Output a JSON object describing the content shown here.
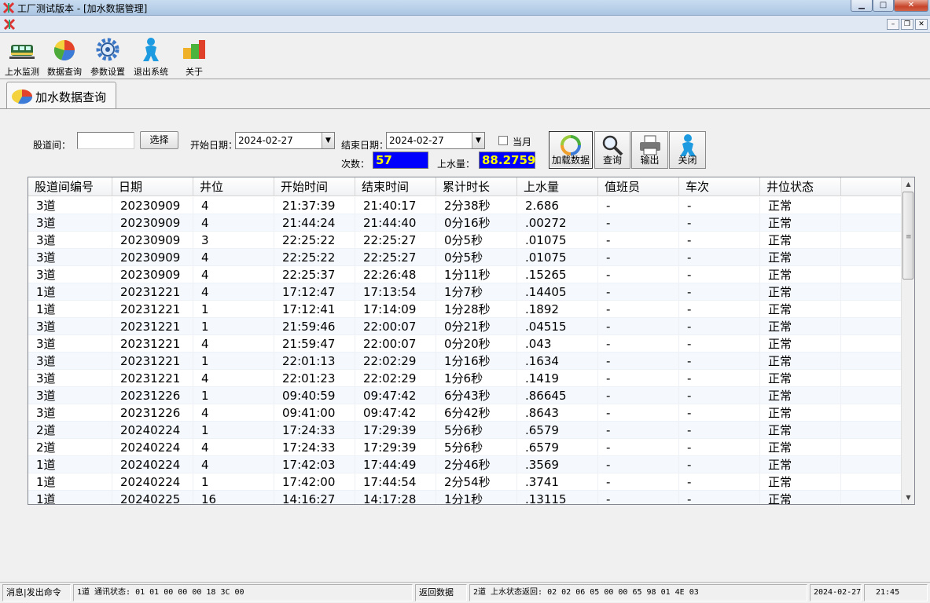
{
  "window": {
    "title": "工厂测试版本 - [加水数据管理]"
  },
  "toolbar": {
    "items": [
      {
        "label": "上水监测",
        "icon": "train-icon"
      },
      {
        "label": "数据查询",
        "icon": "pie-chart-icon"
      },
      {
        "label": "参数设置",
        "icon": "settings-icon"
      },
      {
        "label": "退出系统",
        "icon": "exit-person-icon"
      },
      {
        "label": "关于",
        "icon": "about-blocks-icon"
      }
    ]
  },
  "tab": {
    "label": "加水数据查询"
  },
  "form": {
    "track_label": "股道间：",
    "track_value": "",
    "select_button": "选择",
    "start_date_label": "开始日期：",
    "start_date": "2024-02-27",
    "end_date_label": "结束日期：",
    "end_date": "2024-02-27",
    "month_checkbox_label": "当月",
    "count_label": "次数：",
    "count_value": "57",
    "water_label": "上水量：",
    "water_value": "88.2759"
  },
  "actions": {
    "load": "加载数据",
    "query": "查询",
    "export": "输出",
    "close": "关闭"
  },
  "table": {
    "columns": [
      "股道间编号",
      "日期",
      "井位",
      "开始时间",
      "结束时间",
      "累计时长",
      "上水量",
      "值班员",
      "车次",
      "井位状态"
    ],
    "rows": [
      [
        "3道",
        "20230909",
        "4",
        "21:37:39",
        "21:40:17",
        "2分38秒",
        "2.686",
        "-",
        "-",
        "正常"
      ],
      [
        "3道",
        "20230909",
        "4",
        "21:44:24",
        "21:44:40",
        "0分16秒",
        ".00272",
        "-",
        "-",
        "正常"
      ],
      [
        "3道",
        "20230909",
        "3",
        "22:25:22",
        "22:25:27",
        "0分5秒",
        ".01075",
        "-",
        "-",
        "正常"
      ],
      [
        "3道",
        "20230909",
        "4",
        "22:25:22",
        "22:25:27",
        "0分5秒",
        ".01075",
        "-",
        "-",
        "正常"
      ],
      [
        "3道",
        "20230909",
        "4",
        "22:25:37",
        "22:26:48",
        "1分11秒",
        ".15265",
        "-",
        "-",
        "正常"
      ],
      [
        "1道",
        "20231221",
        "4",
        "17:12:47",
        "17:13:54",
        "1分7秒",
        ".14405",
        "-",
        "-",
        "正常"
      ],
      [
        "1道",
        "20231221",
        "1",
        "17:12:41",
        "17:14:09",
        "1分28秒",
        ".1892",
        "-",
        "-",
        "正常"
      ],
      [
        "3道",
        "20231221",
        "1",
        "21:59:46",
        "22:00:07",
        "0分21秒",
        ".04515",
        "-",
        "-",
        "正常"
      ],
      [
        "3道",
        "20231221",
        "4",
        "21:59:47",
        "22:00:07",
        "0分20秒",
        ".043",
        "-",
        "-",
        "正常"
      ],
      [
        "3道",
        "20231221",
        "1",
        "22:01:13",
        "22:02:29",
        "1分16秒",
        ".1634",
        "-",
        "-",
        "正常"
      ],
      [
        "3道",
        "20231221",
        "4",
        "22:01:23",
        "22:02:29",
        "1分6秒",
        ".1419",
        "-",
        "-",
        "正常"
      ],
      [
        "3道",
        "20231226",
        "1",
        "09:40:59",
        "09:47:42",
        "6分43秒",
        ".86645",
        "-",
        "-",
        "正常"
      ],
      [
        "3道",
        "20231226",
        "4",
        "09:41:00",
        "09:47:42",
        "6分42秒",
        ".8643",
        "-",
        "-",
        "正常"
      ],
      [
        "2道",
        "20240224",
        "1",
        "17:24:33",
        "17:29:39",
        "5分6秒",
        ".6579",
        "-",
        "-",
        "正常"
      ],
      [
        "2道",
        "20240224",
        "4",
        "17:24:33",
        "17:29:39",
        "5分6秒",
        ".6579",
        "-",
        "-",
        "正常"
      ],
      [
        "1道",
        "20240224",
        "4",
        "17:42:03",
        "17:44:49",
        "2分46秒",
        ".3569",
        "-",
        "-",
        "正常"
      ],
      [
        "1道",
        "20240224",
        "1",
        "17:42:00",
        "17:44:54",
        "2分54秒",
        ".3741",
        "-",
        "-",
        "正常"
      ],
      [
        "1道",
        "20240225",
        "16",
        "14:16:27",
        "14:17:28",
        "1分1秒",
        ".13115",
        "-",
        "-",
        "正常"
      ]
    ]
  },
  "statusbar": {
    "msg_panel": "消息|发出命令",
    "comm_status": "1道 通讯状态: 01 01 00 00 00 18 3C 00",
    "return_label": "返回数据",
    "return_status": "2道 上水状态返回: 02 02 06 05 00 00 65 98 01 4E 03",
    "date": "2024-02-27",
    "time": "21:45"
  }
}
